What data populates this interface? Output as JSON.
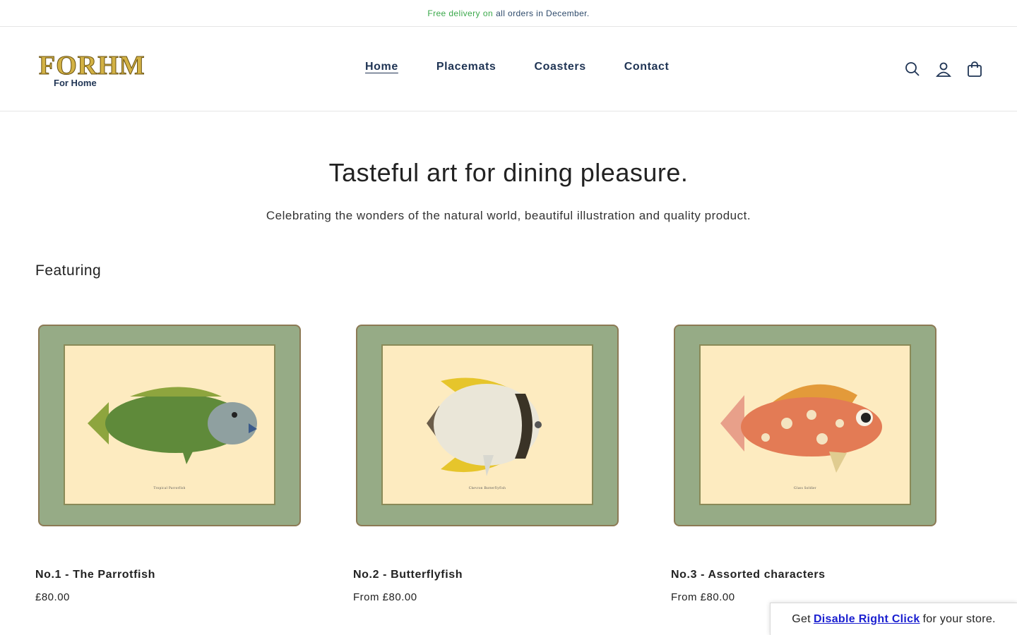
{
  "announcement": {
    "part1": "Free delivery",
    "part2": "on",
    "part3": "all orders in December."
  },
  "header": {
    "logo_word": "FORHM",
    "logo_sub": "For Home",
    "nav": [
      {
        "label": "Home"
      },
      {
        "label": "Placemats"
      },
      {
        "label": "Coasters"
      },
      {
        "label": "Contact"
      }
    ],
    "icons": [
      "search-icon",
      "account-icon",
      "cart-icon"
    ]
  },
  "hero": {
    "heading": "Tasteful art for dining pleasure.",
    "subheading": "Celebrating the wonders of the natural world, beautiful illustration and quality product."
  },
  "featured": {
    "heading": "Featuring",
    "products": [
      {
        "title": "No.1 - The Parrotfish",
        "price": "£80.00",
        "fish_color": "#5f8a3a",
        "fin_color": "#8ea53e",
        "caption": "Tropical Parrotfish"
      },
      {
        "title": "No.2 - Butterflyfish",
        "price": "From £80.00",
        "fish_color": "#eae6d8",
        "fin_color": "#e6c52b",
        "caption": "Chevron Butterflyfish"
      },
      {
        "title": "No.3 - Assorted characters",
        "price": "From £80.00",
        "fish_color": "#e37b55",
        "fin_color": "#e39a3a",
        "caption": "Glass Soldier"
      }
    ]
  },
  "promo": {
    "prefix": "Get",
    "link": "Disable Right Click",
    "suffix": "for your store."
  },
  "colors": {
    "nav_text": "#1f3454",
    "mat_green": "#96ab86",
    "mat_paper": "#fdebc0",
    "delivery_green": "#3aa84a"
  }
}
